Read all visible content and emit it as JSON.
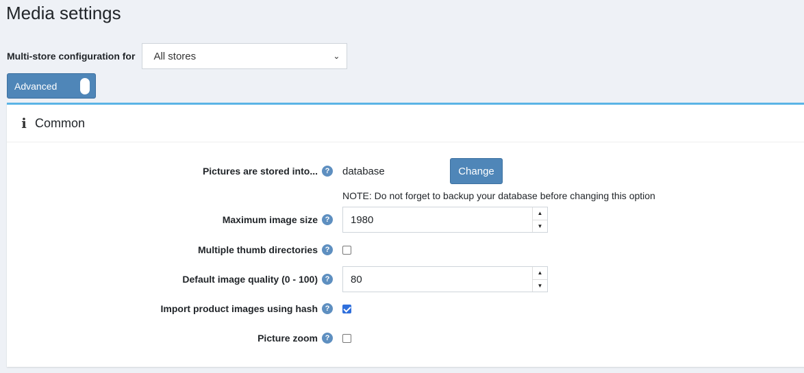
{
  "page": {
    "title": "Media settings"
  },
  "store_config": {
    "label": "Multi-store configuration for",
    "selected": "All stores"
  },
  "advanced_toggle": {
    "label": "Advanced",
    "on": true
  },
  "card": {
    "title": "Common"
  },
  "fields": {
    "pictures_stored": {
      "label": "Pictures are stored into...",
      "value": "database",
      "button": "Change",
      "note": "NOTE: Do not forget to backup your database before changing this option"
    },
    "max_image_size": {
      "label": "Maximum image size",
      "value": "1980"
    },
    "multiple_thumb": {
      "label": "Multiple thumb directories",
      "checked": false
    },
    "default_quality": {
      "label": "Default image quality (0 - 100)",
      "value": "80"
    },
    "import_hash": {
      "label": "Import product images using hash",
      "checked": true
    },
    "picture_zoom": {
      "label": "Picture zoom",
      "checked": false
    }
  },
  "icons": {
    "help": "question-circle-icon",
    "info": "info-icon",
    "dropdown": "chevron-down-icon",
    "spin_up": "spin-up-icon",
    "spin_down": "spin-down-icon"
  },
  "colors": {
    "primary": "#4f86b8",
    "card_accent": "#5ab4e6",
    "checkbox": "#2f6fdc"
  }
}
